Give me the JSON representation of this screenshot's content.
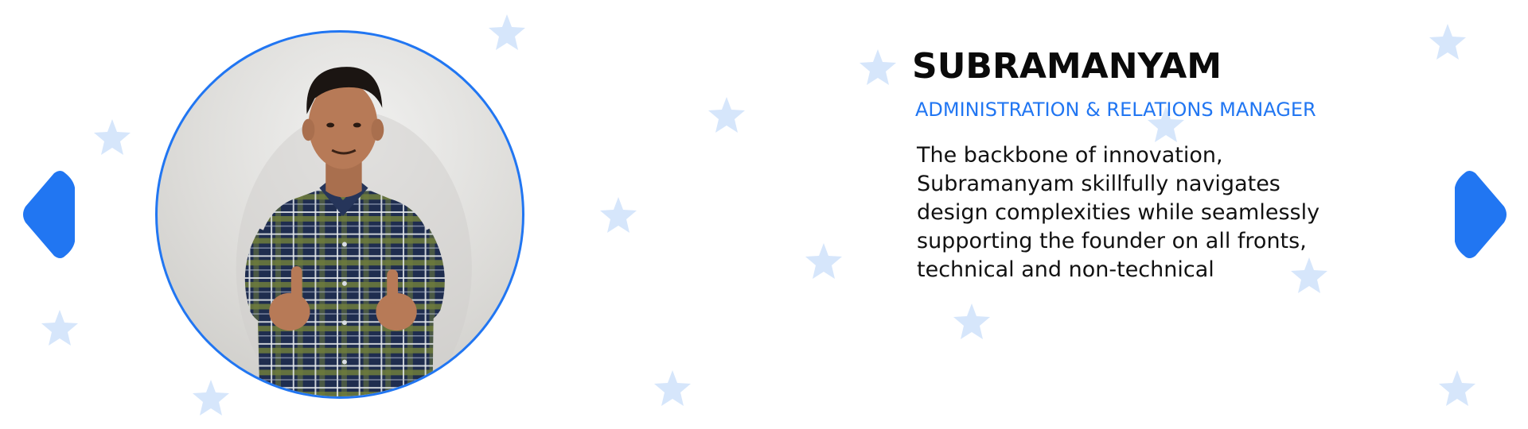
{
  "theme": {
    "accent": "#2176f2",
    "star_color": "#d6e6fb",
    "text_color": "#111111"
  },
  "navigation": {
    "prev_icon": "chevron-left-icon",
    "next_icon": "chevron-right-icon"
  },
  "profile": {
    "photo_icon": "profile-photo",
    "name": "SUBRAMANYAM",
    "role": "ADMINISTRATION & RELATIONS MANAGER",
    "bio": "The backbone of innovation, Subramanyam skillfully navigates design complexities while seamlessly supporting the founder on all fronts, technical and non-technical"
  },
  "decorations": {
    "icon": "star-icon"
  }
}
